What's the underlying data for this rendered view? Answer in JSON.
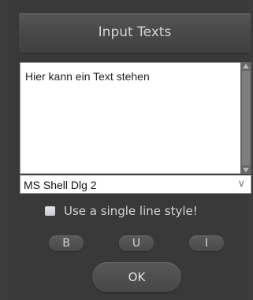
{
  "dialog": {
    "title": "Input Texts",
    "text_area": {
      "value": "Hier kann ein Text stehen"
    },
    "font_select": {
      "value": "MS Shell Dlg 2"
    },
    "checkbox": {
      "label": "Use a single line style!",
      "checked": true
    },
    "format_buttons": {
      "bold": "B",
      "underline": "U",
      "italic": "I"
    },
    "ok_label": "OK"
  },
  "icons": {
    "scroll_up": "triangle-up",
    "scroll_down": "triangle-down",
    "dropdown": "chevron-down"
  },
  "colors": {
    "background": "#393939",
    "button": "#4f4f4f",
    "text": "#d4d4d4",
    "field": "#ffffff"
  }
}
